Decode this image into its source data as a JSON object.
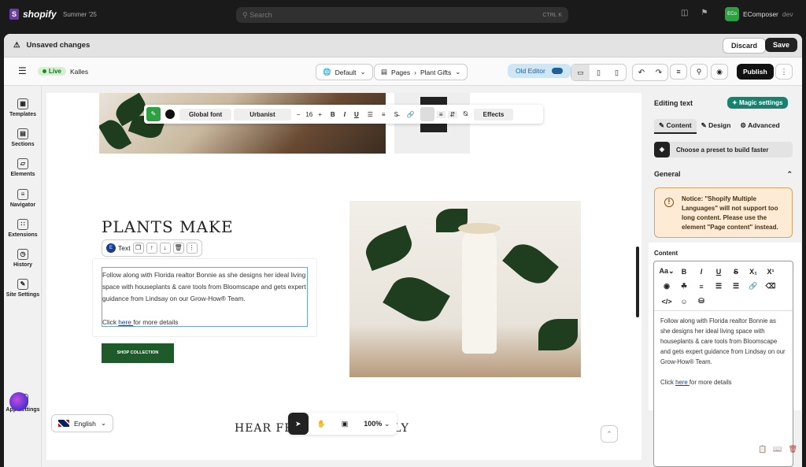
{
  "shopify_bar": {
    "logo": "shopify",
    "season": "Summer '25",
    "search_placeholder": "Search",
    "shortcut": "CTRL K",
    "store_initials": "ECo",
    "store_name": "EComposer",
    "store_suffix": "dev"
  },
  "unsaved": {
    "title": "Unsaved changes",
    "discard_label": "Discard",
    "save_label": "Save"
  },
  "editor_header": {
    "live_label": "Live",
    "theme_name": "Kalles",
    "default_label": "Default",
    "pages_label": "Pages",
    "page_name": "Plant Gifts",
    "old_editor_label": "Old Editor",
    "publish_label": "Publish"
  },
  "left_sidebar": {
    "items": [
      {
        "label": "Templates",
        "icon": "templates-icon"
      },
      {
        "label": "Sections",
        "icon": "sections-icon"
      },
      {
        "label": "Elements",
        "icon": "elements-icon"
      },
      {
        "label": "Navigator",
        "icon": "navigator-icon"
      },
      {
        "label": "Extensions",
        "icon": "extensions-icon"
      },
      {
        "label": "History",
        "icon": "history-icon"
      },
      {
        "label": "Site Settings",
        "icon": "site-settings-icon"
      }
    ],
    "app_settings_label": "App Settings"
  },
  "format_toolbar": {
    "font_label": "Global font",
    "font_name": "Urbanist",
    "font_size": "16",
    "effects_label": "Effects"
  },
  "canvas": {
    "headline": "PLANTS MAKE",
    "element_label": "Text",
    "body_text": "Follow along with Florida realtor Bonnie as she designs her ideal living space with houseplants & care tools from Bloomscape and gets expert guidance from Lindsay on our Grow-How® Team.",
    "click_prefix": "Click ",
    "link_text": "here ",
    "click_suffix": "for more details",
    "button_label": "SHOP COLLECTION",
    "hear_line_left": "HEAR FR",
    "hear_line_right": "FAMILY",
    "language": "English",
    "zoom": "100%"
  },
  "right_panel": {
    "title": "Editing text",
    "magic_label": "Magic settings",
    "tab_content": "Content",
    "tab_design": "Design",
    "tab_advanced": "Advanced",
    "preset_label": "Choose a preset to build faster",
    "general_label": "General",
    "notice_text": "Notice: \"Shopify Multiple Languages\" will not support too long content. Please use the element \"Page content\" instead.",
    "content_label": "Content",
    "rte_text": "Follow along with Florida realtor Bonnie as she designs her ideal living space with houseplants & care tools from Bloomscape and gets expert guidance from Lindsay on our Grow-How® Team.",
    "rte_click_prefix": "Click ",
    "rte_link": "here ",
    "rte_click_suffix": "for more details"
  },
  "colors": {
    "accent_green": "#17826d",
    "shop_button": "#1f5a2a",
    "selection_border": "#6aa5d6"
  }
}
